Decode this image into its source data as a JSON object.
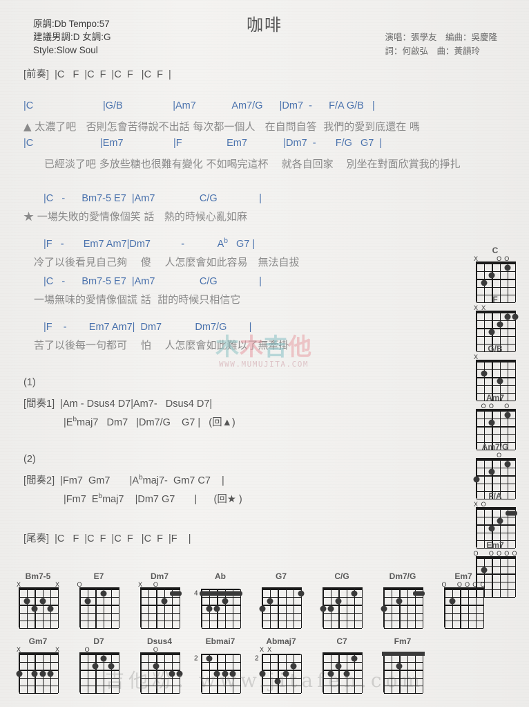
{
  "header": {
    "meta_lines": [
      "原調:Db Tempo:57",
      "建議男調:D 女調:G",
      "Style:Slow Soul"
    ],
    "title": "咖啡",
    "credits": [
      "演唱：張學友　編曲：吳慶隆",
      "詞：何啟弘　曲：黃韻玲"
    ]
  },
  "watermarks": {
    "center_cn": [
      "木",
      "木",
      "吉",
      "他"
    ],
    "center_url": "WWW.MUMUJITA.COM",
    "bottom": "吉他粉：www.jitafen.com"
  },
  "music_lines": [
    {
      "type": "section",
      "text": "[前奏]  |C   F  |C  F  |C  F   |C  F  |"
    },
    {
      "type": "gap-md",
      "text": ""
    },
    {
      "type": "chords",
      "text": "|C                         |G/B                  |Am7             Am7/G      |Dm7  -      F/A G/B   |"
    },
    {
      "type": "lyrics",
      "text": "▲ 太濃了吧   否則怎會苦得說不出話 每次都一個人   在自問自答  我們的愛到底還在 嗎"
    },
    {
      "type": "chords",
      "text": "|C                        |Em7                  |F                Em7             |Dm7  -       F/G   G7  |"
    },
    {
      "type": "lyrics",
      "text": "　　已經淡了吧 多放些糖也很難有變化 不如喝完這杯    就各自回家    別坐在對面欣賞我的掙扎"
    },
    {
      "type": "gap-md",
      "text": ""
    },
    {
      "type": "chords",
      "text": "　　|C   -      Bm7-5 E7  |Am7                C/G               |"
    },
    {
      "type": "lyrics",
      "text": "★ 一場失敗的愛情像個笑 話   熱的時候心亂如麻"
    },
    {
      "type": "gap-sm",
      "text": ""
    },
    {
      "type": "chords",
      "text": "　　|F   -       Em7 Am7|Dm7           -            A♭   G7 |"
    },
    {
      "type": "lyrics",
      "text": "　冷了以後看見自己夠　 傻　 人怎麼會如此容易　無法自拔"
    },
    {
      "type": "chords",
      "text": "　　|C   -      Bm7-5 E7  |Am7                C/G               |"
    },
    {
      "type": "lyrics",
      "text": "　一場無味的愛情像個謊 話  甜的時候只相信它"
    },
    {
      "type": "gap-sm",
      "text": ""
    },
    {
      "type": "chords",
      "text": "　　|F    -        Em7 Am7|  Dm7            Dm7/G        |"
    },
    {
      "type": "lyrics",
      "text": "　苦了以後每一句都可　 怕　 人怎麼會如此難以了無牽掛"
    },
    {
      "type": "gap-lg",
      "text": ""
    },
    {
      "type": "section",
      "text": "(1)"
    },
    {
      "type": "section",
      "text": "[間奏1]  |Am - Dsus4 D7|Am7-   Dsus4 D7|"
    },
    {
      "type": "section",
      "text": "　　　　|E♭maj7   Dm7   |Dm7/G    G7 |   (回▲)"
    },
    {
      "type": "gap-lg",
      "text": ""
    },
    {
      "type": "section",
      "text": "(2)"
    },
    {
      "type": "section",
      "text": "[間奏2]  |Fm7  Gm7       |A♭maj7-  Gm7 C7    |"
    },
    {
      "type": "section",
      "text": "　　　　|Fm7  E♭maj7    |Dm7 G7       |      (回★ )"
    },
    {
      "type": "gap-lg",
      "text": ""
    },
    {
      "type": "section",
      "text": "[尾奏]  |C   F  |C  F  |C  F   |C  F  |F    |"
    }
  ],
  "chord_diagrams_right": [
    {
      "name": "C",
      "markers": [
        {
          "s": 1,
          "m": "X"
        },
        {
          "s": 4,
          "m": "O"
        },
        {
          "s": 5,
          "m": "O"
        }
      ],
      "dots": [
        {
          "s": 2,
          "f": 3
        },
        {
          "s": 3,
          "f": 2
        },
        {
          "s": 5,
          "f": 1
        }
      ],
      "barres": [],
      "fret": ""
    },
    {
      "name": "F",
      "markers": [
        {
          "s": 1,
          "m": "X"
        },
        {
          "s": 2,
          "m": "X"
        }
      ],
      "dots": [
        {
          "s": 3,
          "f": 3
        },
        {
          "s": 4,
          "f": 2
        },
        {
          "s": 5,
          "f": 1
        },
        {
          "s": 6,
          "f": 1
        }
      ],
      "barres": [],
      "fret": ""
    },
    {
      "name": "G/B",
      "markers": [
        {
          "s": 1,
          "m": "X"
        }
      ],
      "dots": [
        {
          "s": 2,
          "f": 2
        },
        {
          "s": 4,
          "f": 3
        }
      ],
      "barres": [],
      "fret": ""
    },
    {
      "name": "Am7",
      "markers": [
        {
          "s": 2,
          "m": "O"
        },
        {
          "s": 3,
          "m": "O"
        },
        {
          "s": 5,
          "m": "O"
        }
      ],
      "dots": [
        {
          "s": 3,
          "f": 2
        },
        {
          "s": 5,
          "f": 1
        }
      ],
      "barres": [],
      "fret": ""
    },
    {
      "name": "Am7/G",
      "markers": [
        {
          "s": 4,
          "m": "O"
        }
      ],
      "dots": [
        {
          "s": 1,
          "f": 3
        },
        {
          "s": 3,
          "f": 2
        },
        {
          "s": 5,
          "f": 1
        }
      ],
      "barres": [],
      "fret": ""
    },
    {
      "name": "F/A",
      "markers": [
        {
          "s": 1,
          "m": "X"
        },
        {
          "s": 2,
          "m": "O"
        }
      ],
      "dots": [
        {
          "s": 3,
          "f": 3
        },
        {
          "s": 4,
          "f": 2
        }
      ],
      "barres": [
        {
          "from": 5,
          "to": 6,
          "f": 1
        }
      ],
      "fret": ""
    },
    {
      "name": "Em7",
      "markers": [
        {
          "s": 1,
          "m": "O"
        },
        {
          "s": 3,
          "m": "O"
        },
        {
          "s": 4,
          "m": "O"
        },
        {
          "s": 5,
          "m": "O"
        },
        {
          "s": 6,
          "m": "O"
        }
      ],
      "dots": [
        {
          "s": 2,
          "f": 2
        }
      ],
      "barres": [],
      "fret": ""
    }
  ],
  "chord_diagrams_bottom_row1": [
    {
      "name": "Bm7-5",
      "markers": [
        {
          "s": 1,
          "m": "X"
        },
        {
          "s": 6,
          "m": "X"
        }
      ],
      "dots": [
        {
          "s": 2,
          "f": 2
        },
        {
          "s": 4,
          "f": 2
        },
        {
          "s": 3,
          "f": 3
        },
        {
          "s": 5,
          "f": 3
        }
      ],
      "barres": [],
      "fret": ""
    },
    {
      "name": "E7",
      "markers": [
        {
          "s": 1,
          "m": "O"
        }
      ],
      "dots": [
        {
          "s": 2,
          "f": 2
        },
        {
          "s": 4,
          "f": 1
        }
      ],
      "barres": [],
      "fret": ""
    },
    {
      "name": "Dm7",
      "markers": [
        {
          "s": 1,
          "m": "X"
        },
        {
          "s": 3,
          "m": "O"
        }
      ],
      "dots": [
        {
          "s": 4,
          "f": 2
        }
      ],
      "barres": [
        {
          "from": 5,
          "to": 6,
          "f": 1
        }
      ],
      "fret": ""
    },
    {
      "name": "Ab",
      "markers": [],
      "dots": [
        {
          "s": 2,
          "f": 3
        },
        {
          "s": 3,
          "f": 3
        },
        {
          "s": 4,
          "f": 2
        }
      ],
      "barres": [
        {
          "from": 1,
          "to": 6,
          "f": 1
        }
      ],
      "fret": "4"
    },
    {
      "name": "G7",
      "markers": [],
      "dots": [
        {
          "s": 1,
          "f": 3
        },
        {
          "s": 2,
          "f": 2
        },
        {
          "s": 6,
          "f": 1
        }
      ],
      "barres": [],
      "fret": ""
    },
    {
      "name": "C/G",
      "markers": [],
      "dots": [
        {
          "s": 1,
          "f": 3
        },
        {
          "s": 2,
          "f": 3
        },
        {
          "s": 3,
          "f": 2
        },
        {
          "s": 5,
          "f": 1
        }
      ],
      "barres": [],
      "fret": ""
    },
    {
      "name": "Dm7/G",
      "markers": [],
      "dots": [
        {
          "s": 1,
          "f": 3
        },
        {
          "s": 3,
          "f": 2
        }
      ],
      "barres": [
        {
          "from": 5,
          "to": 6,
          "f": 1
        }
      ],
      "fret": ""
    },
    {
      "name": "Em7",
      "markers": [
        {
          "s": 1,
          "m": "O"
        },
        {
          "s": 3,
          "m": "O"
        },
        {
          "s": 4,
          "m": "O"
        },
        {
          "s": 5,
          "m": "O"
        },
        {
          "s": 6,
          "m": "O"
        }
      ],
      "dots": [
        {
          "s": 2,
          "f": 2
        }
      ],
      "barres": [],
      "fret": ""
    }
  ],
  "chord_diagrams_bottom_row2": [
    {
      "name": "Gm7",
      "markers": [
        {
          "s": 1,
          "m": "X"
        },
        {
          "s": 6,
          "m": "X"
        }
      ],
      "dots": [
        {
          "s": 1,
          "f": 3
        },
        {
          "s": 3,
          "f": 3
        },
        {
          "s": 4,
          "f": 3
        },
        {
          "s": 5,
          "f": 3
        }
      ],
      "barres": [],
      "fret": ""
    },
    {
      "name": "D7",
      "markers": [
        {
          "s": 2,
          "m": "O"
        }
      ],
      "dots": [
        {
          "s": 4,
          "f": 1
        },
        {
          "s": 3,
          "f": 2
        },
        {
          "s": 5,
          "f": 2
        }
      ],
      "barres": [],
      "fret": ""
    },
    {
      "name": "Dsus4",
      "markers": [
        {
          "s": 3,
          "m": "O"
        }
      ],
      "dots": [
        {
          "s": 3,
          "f": 2
        },
        {
          "s": 5,
          "f": 3
        },
        {
          "s": 6,
          "f": 3
        }
      ],
      "barres": [],
      "fret": ""
    },
    {
      "name": "Ebmai7",
      "markers": [],
      "dots": [
        {
          "s": 2,
          "f": 1
        },
        {
          "s": 3,
          "f": 3
        },
        {
          "s": 4,
          "f": 3
        },
        {
          "s": 5,
          "f": 3
        }
      ],
      "barres": [],
      "fret": "2"
    },
    {
      "name": "Abmaj7",
      "markers": [
        {
          "s": 1,
          "m": "X"
        },
        {
          "s": 2,
          "m": "X"
        }
      ],
      "dots": [
        {
          "s": 1,
          "f": 3
        },
        {
          "s": 4,
          "f": 3
        },
        {
          "s": 3,
          "f": 4
        },
        {
          "s": 5,
          "f": 2
        }
      ],
      "barres": [],
      "fret": "2"
    },
    {
      "name": "C7",
      "markers": [],
      "dots": [
        {
          "s": 2,
          "f": 3
        },
        {
          "s": 3,
          "f": 2
        },
        {
          "s": 4,
          "f": 3
        },
        {
          "s": 5,
          "f": 1
        }
      ],
      "barres": [],
      "fret": ""
    },
    {
      "name": "Fm7",
      "markers": [],
      "dots": [
        {
          "s": 3,
          "f": 2
        }
      ],
      "barres": [
        {
          "from": 1,
          "to": 6,
          "f": 0
        }
      ],
      "fret": ""
    }
  ]
}
